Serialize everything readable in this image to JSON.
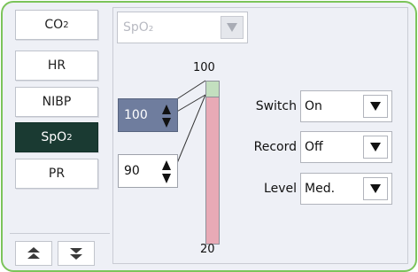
{
  "nav": {
    "items": [
      {
        "label_main": "CO",
        "label_sub": "2",
        "active": false
      },
      {
        "label_main": "HR",
        "label_sub": "",
        "active": false
      },
      {
        "label_main": "NIBP",
        "label_sub": "",
        "active": false
      },
      {
        "label_main": "SpO",
        "label_sub": "2",
        "active": true
      },
      {
        "label_main": "PR",
        "label_sub": "",
        "active": false
      }
    ],
    "scroll_up_icon": "double-up-arrow",
    "scroll_down_icon": "double-down-arrow"
  },
  "parameter_select": {
    "value": "SpO₂"
  },
  "alarm_limits": {
    "upper_value": "100",
    "lower_value": "90",
    "scale_max": "100",
    "scale_min": "20",
    "range_fraction": 0.1
  },
  "settings": {
    "switch": {
      "label": "Switch",
      "value": "On"
    },
    "record": {
      "label": "Record",
      "value": "Off"
    },
    "level": {
      "label": "Level",
      "value": "Med."
    }
  },
  "colors": {
    "frame": "#7cc45a",
    "active_nav": "#1a3a32",
    "selected_spin": "#6f7d9e",
    "bar_fill": "#e8aab6",
    "bar_range": "#c3dfbf"
  }
}
